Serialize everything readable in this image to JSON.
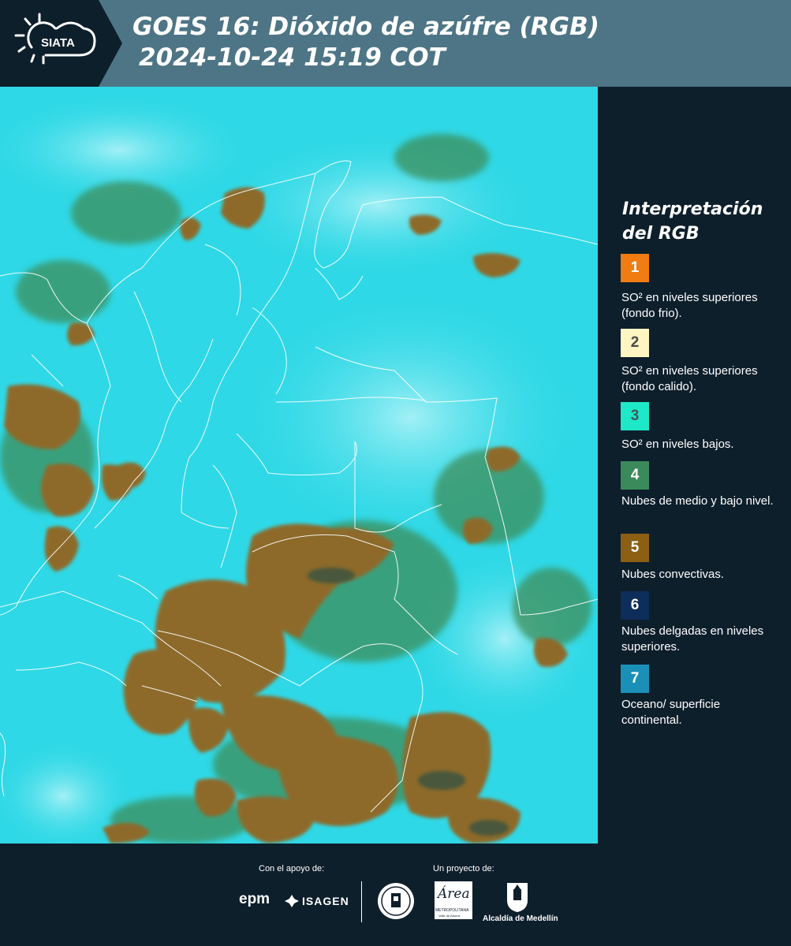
{
  "header": {
    "logo_text": "SIATA",
    "title_line1": "GOES 16: Dióxido de azúfre (RGB)",
    "title_line2": "2024-10-24 15:19 COT"
  },
  "legend": {
    "title_line1": "Interpretación",
    "title_line2": "del RGB",
    "items": [
      {
        "num": "1",
        "color": "#f07c12",
        "text_color": "#ffffff",
        "label": "SO² en niveles superiores (fondo frio)."
      },
      {
        "num": "2",
        "color": "#fdf6c2",
        "text_color": "#4a4a4a",
        "label": "SO² en niveles superiores (fondo calido)."
      },
      {
        "num": "3",
        "color": "#1ee8c8",
        "text_color": "#3a5a5a",
        "label": "SO² en niveles bajos."
      },
      {
        "num": "4",
        "color": "#3b8a5c",
        "text_color": "#ffffff",
        "label": "Nubes de medio y bajo nivel."
      },
      {
        "num": "5",
        "color": "#8d5f12",
        "text_color": "#ffffff",
        "label": "Nubes convectivas."
      },
      {
        "num": "6",
        "color": "#0d2d5a",
        "text_color": "#ffffff",
        "label": "Nubes delgadas en niveles superiores."
      },
      {
        "num": "7",
        "color": "#1a8fb8",
        "text_color": "#ffffff",
        "label": "Oceano/ superficie continental."
      }
    ]
  },
  "map": {
    "background_color": "#2fd8e6",
    "cloud_color": "#8d6a2a",
    "green_color": "#3e8e5a",
    "border_color": "#ffffff"
  },
  "footer": {
    "support_label": "Con el apoyo de:",
    "project_label": "Un proyecto de:",
    "epm": "epm",
    "isagen": "ISAGEN",
    "metropolitana_name": "Área",
    "metropolitana_sub": "METROPOLITANA",
    "metropolitana_sub2": "Valle de Aburrá",
    "alcaldia": "Alcaldía de Medellín"
  }
}
